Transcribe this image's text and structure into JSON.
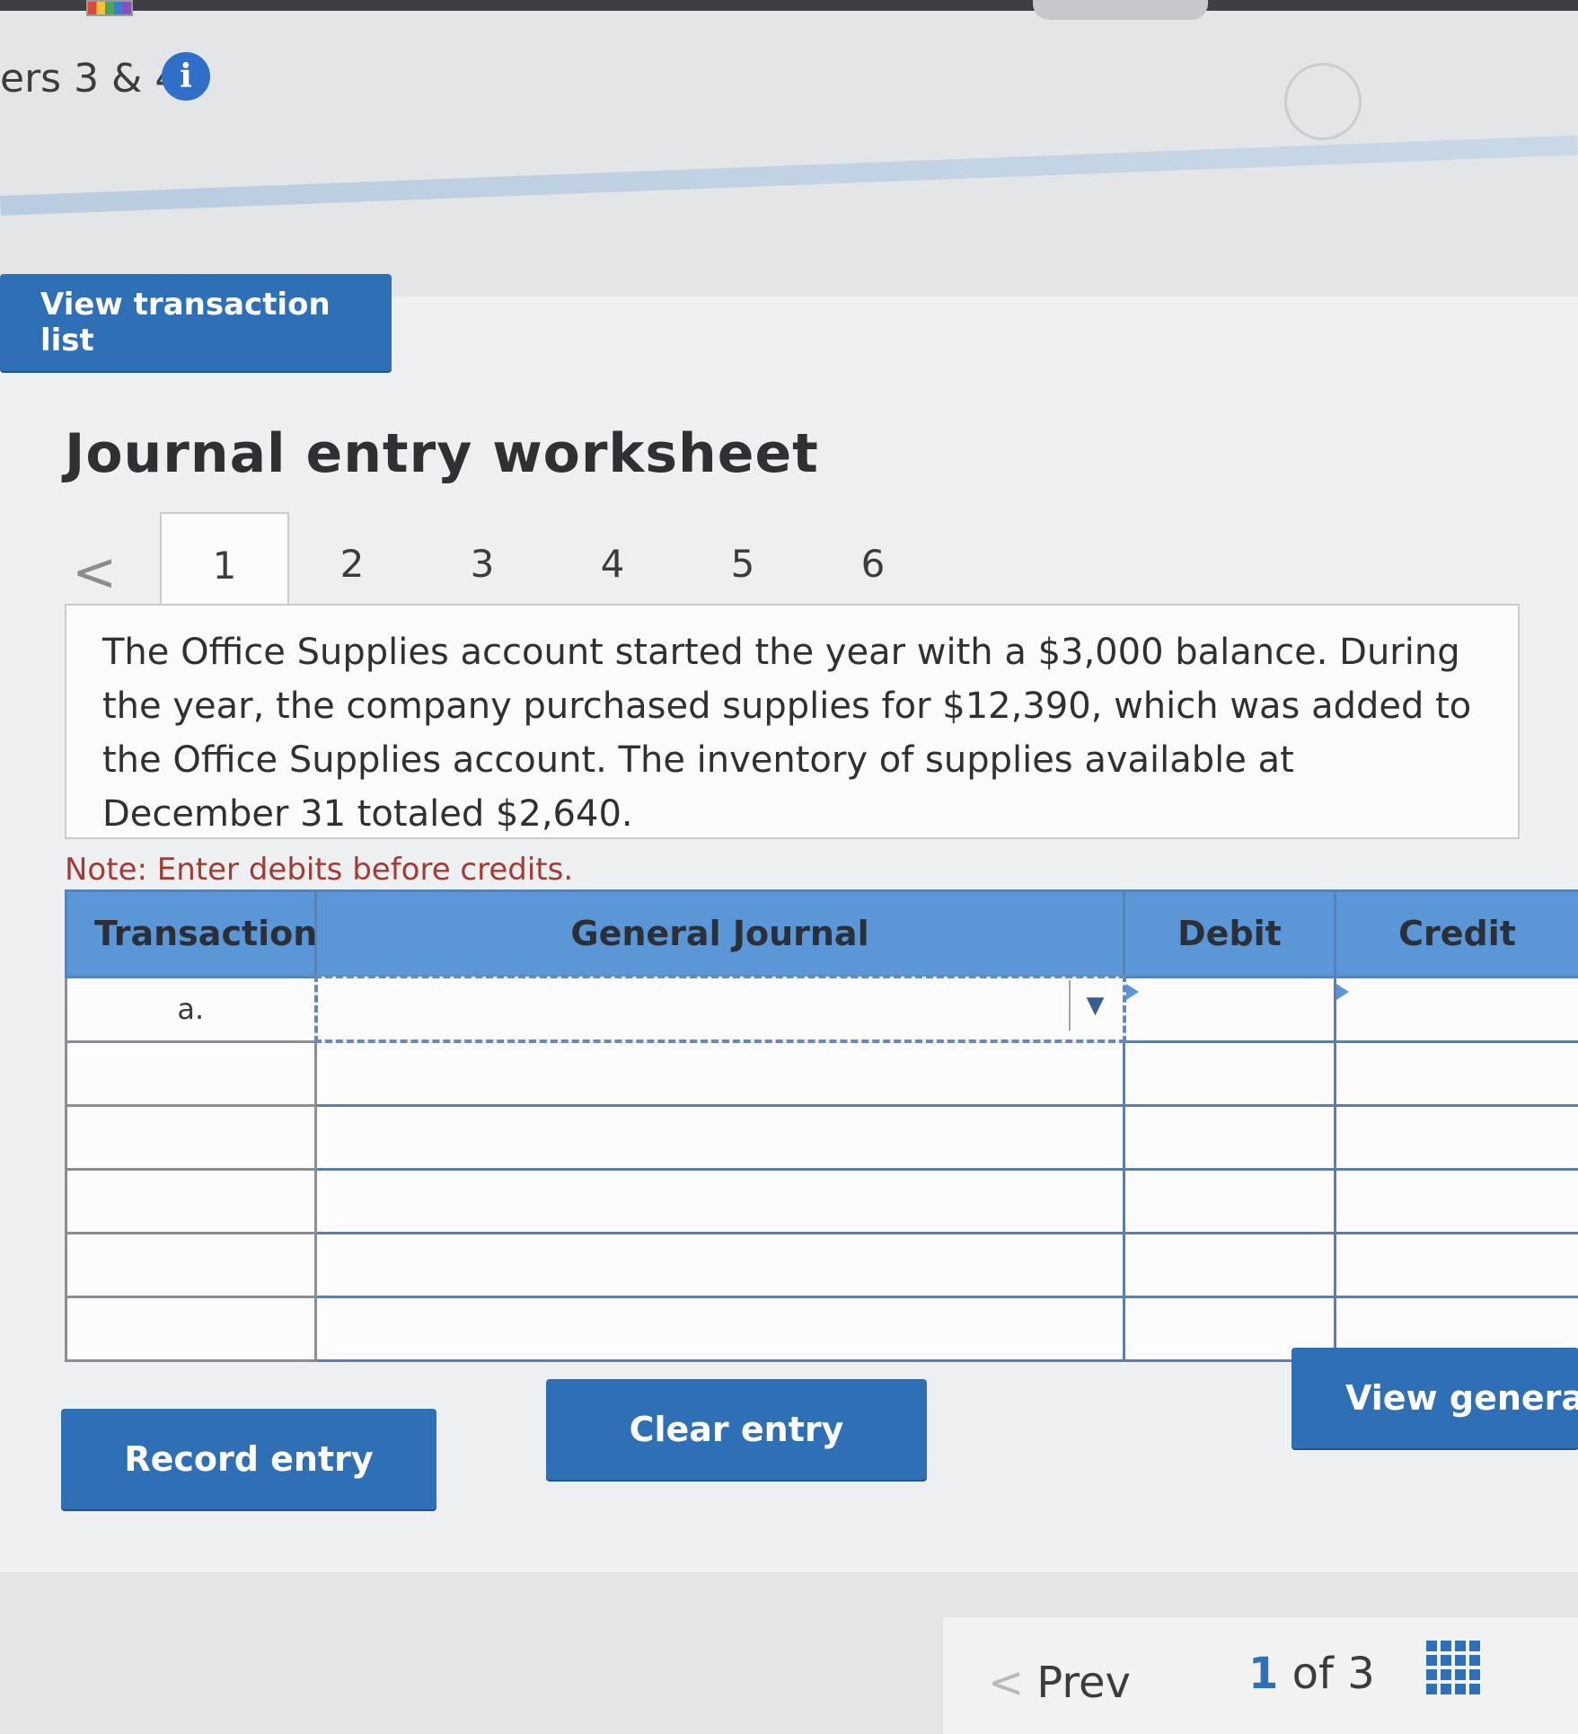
{
  "header": {
    "chapter_title_fragment": "ers 3 & 4)"
  },
  "buttons": {
    "view_transaction_list": "View transaction list",
    "record_entry": "Record entry",
    "clear_entry": "Clear entry",
    "view_general_journal": "View general"
  },
  "worksheet": {
    "title": "Journal entry worksheet",
    "tabs": [
      "1",
      "2",
      "3",
      "4",
      "5",
      "6"
    ],
    "active_tab": "1",
    "question": "The Office Supplies account started the year with a $3,000 balance. During the year, the company purchased supplies for $12,390, which was added to the Office Supplies account. The inventory of supplies available at December 31 totaled $2,640.",
    "note": "Note: Enter debits before credits."
  },
  "journal_table": {
    "headers": {
      "transaction": "Transaction",
      "general_journal": "General Journal",
      "debit": "Debit",
      "credit": "Credit"
    },
    "rows": [
      {
        "transaction": "a.",
        "account": "",
        "debit": "",
        "credit": ""
      },
      {
        "transaction": "",
        "account": "",
        "debit": "",
        "credit": ""
      },
      {
        "transaction": "",
        "account": "",
        "debit": "",
        "credit": ""
      },
      {
        "transaction": "",
        "account": "",
        "debit": "",
        "credit": ""
      },
      {
        "transaction": "",
        "account": "",
        "debit": "",
        "credit": ""
      },
      {
        "transaction": "",
        "account": "",
        "debit": "",
        "credit": ""
      }
    ]
  },
  "footer": {
    "prev_label": "Prev",
    "current_page": "1",
    "of_label": "of",
    "total_pages": "3"
  },
  "colors": {
    "accent_blue": "#2f6fb5",
    "header_blue": "#5b96d6",
    "note_red": "#a23a35"
  },
  "icons": {
    "info": "info-icon",
    "prev": "chevron-left-icon",
    "grid": "grid-view-icon",
    "dropdown": "caret-down-icon"
  }
}
